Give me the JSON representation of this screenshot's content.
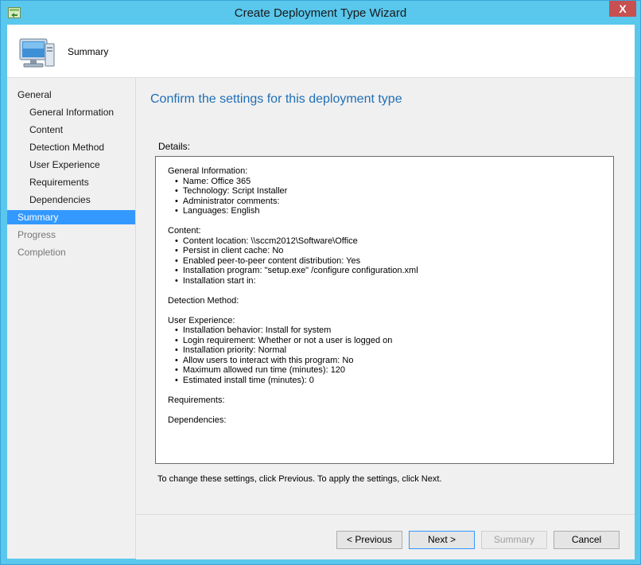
{
  "window": {
    "title": "Create Deployment Type Wizard",
    "close_glyph": "X",
    "app_icon": "wizard-app-icon"
  },
  "header": {
    "title": "Summary",
    "icon": "computer-icon"
  },
  "nav": {
    "items": [
      {
        "label": "General",
        "level": 0,
        "state": "normal"
      },
      {
        "label": "General Information",
        "level": 1,
        "state": "normal"
      },
      {
        "label": "Content",
        "level": 1,
        "state": "normal"
      },
      {
        "label": "Detection Method",
        "level": 1,
        "state": "normal"
      },
      {
        "label": "User Experience",
        "level": 1,
        "state": "normal"
      },
      {
        "label": "Requirements",
        "level": 1,
        "state": "normal"
      },
      {
        "label": "Dependencies",
        "level": 1,
        "state": "normal"
      },
      {
        "label": "Summary",
        "level": 0,
        "state": "selected"
      },
      {
        "label": "Progress",
        "level": 0,
        "state": "disabled"
      },
      {
        "label": "Completion",
        "level": 0,
        "state": "disabled"
      }
    ]
  },
  "main": {
    "title": "Confirm the settings for this deployment type",
    "details_label": "Details:",
    "footer_text": "To change these settings, click Previous. To apply the settings, click Next.",
    "details": {
      "general_heading": "General Information:",
      "general_items": [
        "Name: Office 365",
        "Technology: Script Installer",
        "Administrator comments:",
        "Languages: English"
      ],
      "content_heading": "Content:",
      "content_items": [
        "Content location: \\\\sccm2012\\Software\\Office",
        "Persist in client cache: No",
        "Enabled peer-to-peer content distribution: Yes",
        "Installation program: \"setup.exe\"  /configure configuration.xml",
        "Installation start in:"
      ],
      "detection_heading": "Detection Method:",
      "ux_heading": "User Experience:",
      "ux_items": [
        "Installation behavior: Install for system",
        "Login requirement: Whether or not a user is logged on",
        "Installation priority: Normal",
        "Allow users to interact with this program: No",
        "Maximum allowed run time (minutes): 120",
        "Estimated install time (minutes): 0"
      ],
      "requirements_heading": "Requirements:",
      "dependencies_heading": "Dependencies:"
    }
  },
  "buttons": {
    "previous": "< Previous",
    "next": "Next >",
    "summary": "Summary",
    "cancel": "Cancel"
  },
  "colors": {
    "titlebar": "#5ac7ed",
    "selected": "#3399ff",
    "heading": "#1f6fb6"
  }
}
